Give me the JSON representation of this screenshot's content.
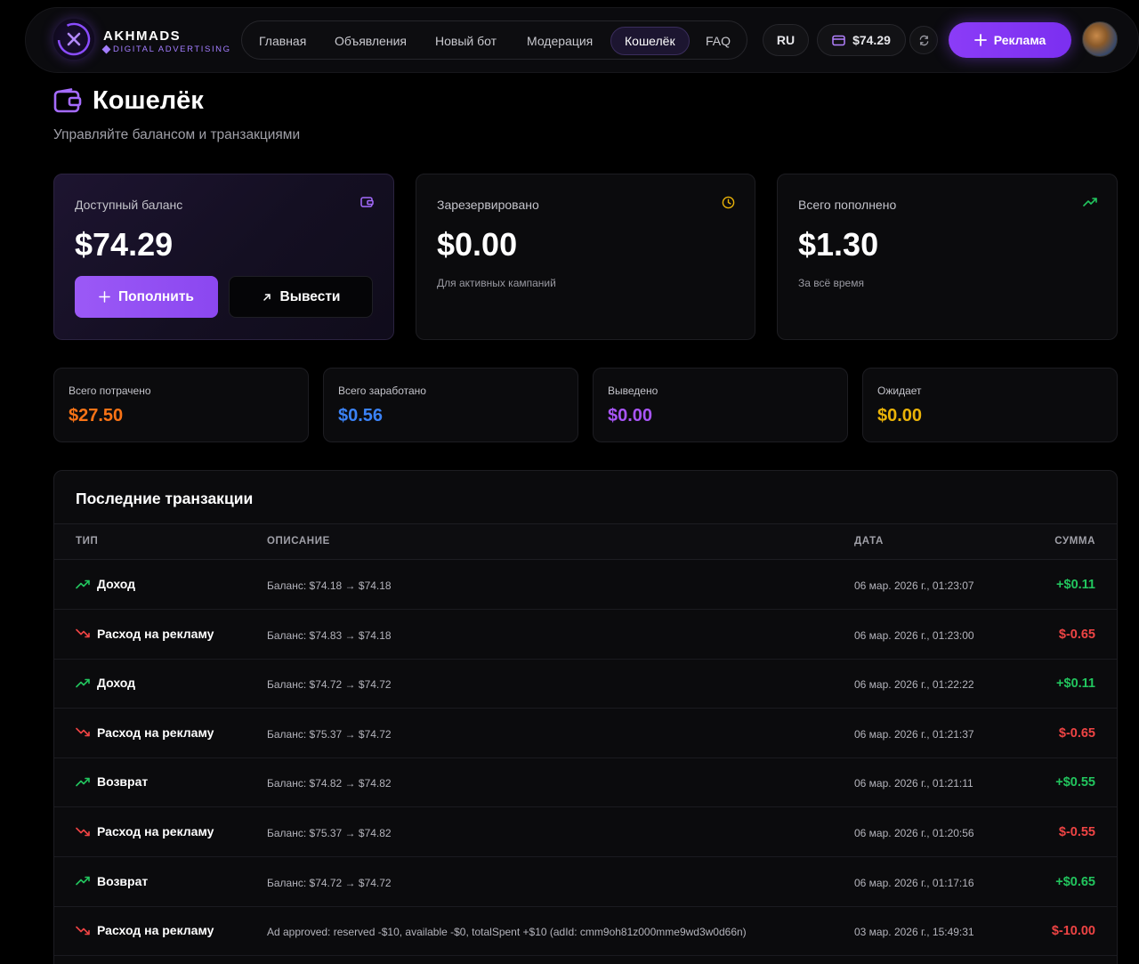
{
  "brand": {
    "name": "AKHMADS",
    "tagline": "DIGITAL ADVERTISING"
  },
  "nav": [
    {
      "label": "Главная",
      "active": false
    },
    {
      "label": "Объявления",
      "active": false
    },
    {
      "label": "Новый бот",
      "active": false
    },
    {
      "label": "Модерация",
      "active": false
    },
    {
      "label": "Кошелёк",
      "active": true
    },
    {
      "label": "FAQ",
      "active": false
    }
  ],
  "header": {
    "language": "RU",
    "balance": "$74.29",
    "ad_button": "Реклама"
  },
  "page": {
    "title": "Кошелёк",
    "subtitle": "Управляйте балансом и транзакциями"
  },
  "cards": {
    "available": {
      "label": "Доступный баланс",
      "value": "$74.29",
      "topup": "Пополнить",
      "withdraw": "Вывести"
    },
    "reserved": {
      "label": "Зарезервировано",
      "value": "$0.00",
      "note": "Для активных кампаний"
    },
    "total_topped": {
      "label": "Всего пополнено",
      "value": "$1.30",
      "note": "За всё время"
    }
  },
  "stats": [
    {
      "label": "Всего потрачено",
      "value": "$27.50",
      "color": "#f97316"
    },
    {
      "label": "Всего заработано",
      "value": "$0.56",
      "color": "#3b82f6"
    },
    {
      "label": "Выведено",
      "value": "$0.00",
      "color": "#a855f7"
    },
    {
      "label": "Ожидает",
      "value": "$0.00",
      "color": "#eab308"
    }
  ],
  "transactions": {
    "title": "Последние транзакции",
    "columns": {
      "type": "ТИП",
      "description": "ОПИСАНИЕ",
      "date": "ДАТА",
      "amount": "СУММА"
    },
    "rows": [
      {
        "direction": "up",
        "type": "Доход",
        "description": "Баланс: $74.18 → $74.18",
        "date": "06 мар. 2026 г., 01:23:07",
        "amount": "+$0.11"
      },
      {
        "direction": "down",
        "type": "Расход на рекламу",
        "description": "Баланс: $74.83 → $74.18",
        "date": "06 мар. 2026 г., 01:23:00",
        "amount": "$-0.65"
      },
      {
        "direction": "up",
        "type": "Доход",
        "description": "Баланс: $74.72 → $74.72",
        "date": "06 мар. 2026 г., 01:22:22",
        "amount": "+$0.11"
      },
      {
        "direction": "down",
        "type": "Расход на рекламу",
        "description": "Баланс: $75.37 → $74.72",
        "date": "06 мар. 2026 г., 01:21:37",
        "amount": "$-0.65"
      },
      {
        "direction": "up",
        "type": "Возврат",
        "description": "Баланс: $74.82 → $74.82",
        "date": "06 мар. 2026 г., 01:21:11",
        "amount": "+$0.55"
      },
      {
        "direction": "down",
        "type": "Расход на рекламу",
        "description": "Баланс: $75.37 → $74.82",
        "date": "06 мар. 2026 г., 01:20:56",
        "amount": "$-0.55"
      },
      {
        "direction": "up",
        "type": "Возврат",
        "description": "Баланс: $74.72 → $74.72",
        "date": "06 мар. 2026 г., 01:17:16",
        "amount": "+$0.65"
      },
      {
        "direction": "down",
        "type": "Расход на рекламу",
        "description": "Ad approved: reserved -$10, available -$0, totalSpent +$10 (adId: cmm9oh81z000mme9wd3w0d66n)",
        "date": "03 мар. 2026 г., 15:49:31",
        "amount": "$-10.00"
      }
    ]
  }
}
